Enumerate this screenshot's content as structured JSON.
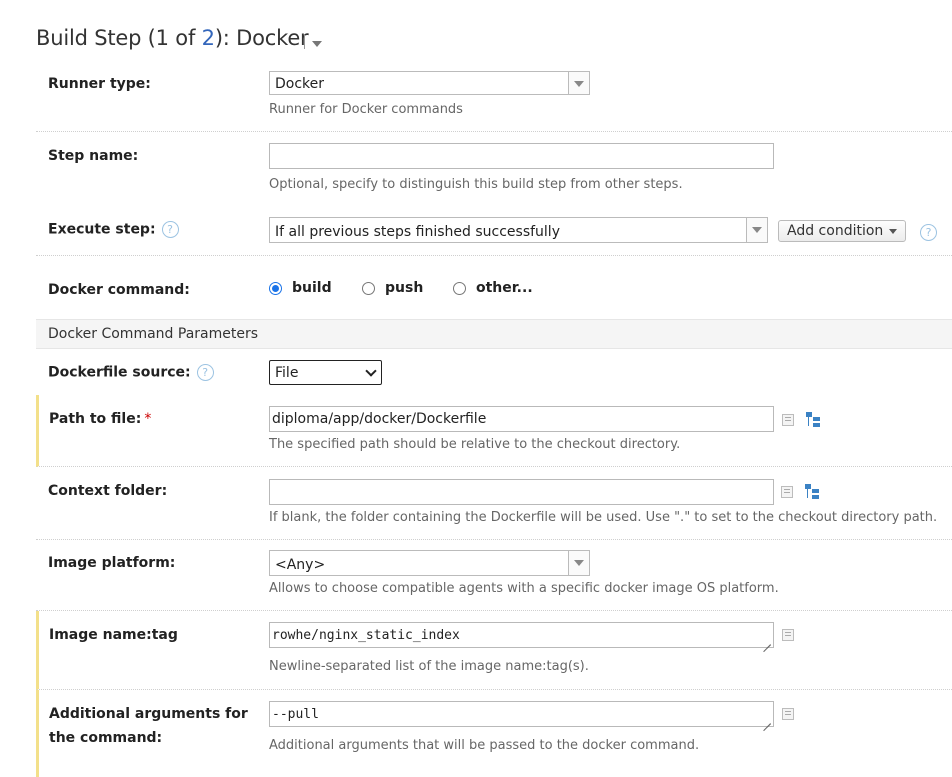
{
  "heading": {
    "prefix": "Build Step (1 of ",
    "step_total": "2",
    "suffix": "): Docker"
  },
  "runner_type": {
    "label": "Runner type:",
    "value": "Docker",
    "note": "Runner for Docker commands"
  },
  "step_name": {
    "label": "Step name:",
    "value": "",
    "note": "Optional, specify to distinguish this build step from other steps."
  },
  "execute_step": {
    "label": "Execute step:",
    "value": "If all previous steps finished successfully",
    "add_condition": "Add condition"
  },
  "docker_command": {
    "label": "Docker command:",
    "options": [
      {
        "label": "build",
        "selected": true
      },
      {
        "label": "push",
        "selected": false
      },
      {
        "label": "other...",
        "selected": false
      }
    ]
  },
  "section_title": "Docker Command Parameters",
  "dockerfile_source": {
    "label": "Dockerfile source:",
    "value": "File"
  },
  "path_to_file": {
    "label": "Path to file:",
    "required_mark": "*",
    "value": "diploma/app/docker/Dockerfile",
    "note": "The specified path should be relative to the checkout directory."
  },
  "context_folder": {
    "label": "Context folder:",
    "value": "",
    "note": "If blank, the folder containing the Dockerfile will be used. Use \".\" to set to the checkout directory path."
  },
  "image_platform": {
    "label": "Image platform:",
    "value": "<Any>",
    "note": "Allows to choose compatible agents with a specific docker image OS platform."
  },
  "image_name_tag": {
    "label": "Image name:tag",
    "value": "rowhe/nginx_static_index",
    "note": "Newline-separated list of the image name:tag(s)."
  },
  "additional_args": {
    "label": "Additional arguments for the command:",
    "value": "--pull",
    "note": "Additional arguments that will be passed to the docker command."
  },
  "help_glyph": "?",
  "icons": [
    "dropdown-arrow-icon",
    "help-icon",
    "list-icon",
    "tree-icon",
    "resize-grip-icon"
  ],
  "colors": {
    "accent": "#1a73e8",
    "link": "#3366bb",
    "required_bar": "#f3e08a",
    "required_star": "#cc0000"
  }
}
